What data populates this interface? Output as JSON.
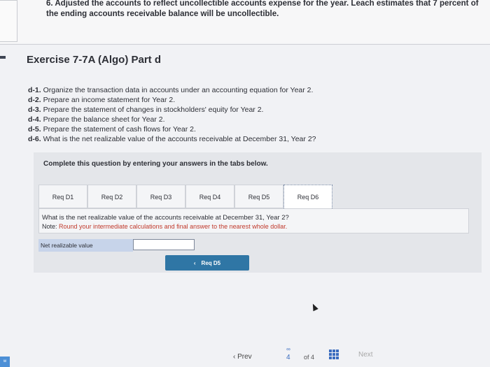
{
  "step": {
    "text": "6. Adjusted the accounts to reflect uncollectible accounts expense for the year. Leach estimates that 7 percent of the ending accounts receivable balance will be uncollectible."
  },
  "exercise": {
    "title": "Exercise 7-7A (Algo) Part d"
  },
  "requirements": [
    {
      "label": "d-1.",
      "text": "Organize the transaction data in accounts under an accounting equation for Year 2."
    },
    {
      "label": "d-2.",
      "text": "Prepare an income statement for Year 2."
    },
    {
      "label": "d-3.",
      "text": "Prepare the statement of changes in stockholders' equity for Year 2."
    },
    {
      "label": "d-4.",
      "text": "Prepare the balance sheet for Year 2."
    },
    {
      "label": "d-5.",
      "text": "Prepare the statement of cash flows for Year 2."
    },
    {
      "label": "d-6.",
      "text": "What is the net realizable value of the accounts receivable at December 31, Year 2?"
    }
  ],
  "panel": {
    "instruction": "Complete this question by entering your answers in the tabs below.",
    "tabs": [
      "Req D1",
      "Req D2",
      "Req D3",
      "Req D4",
      "Req D5",
      "Req D6"
    ],
    "active_tab": "Req D6",
    "question": "What is the net realizable value of the accounts receivable at December 31, Year 2?",
    "note_label": "Note:",
    "note_text": "Round your intermediate calculations and final answer to the nearest whole dollar.",
    "answer_label": "Net realizable value",
    "answer_value": "",
    "prev_tab_button": "Req D5"
  },
  "footer": {
    "badge": "w",
    "prev": "Prev",
    "page": "4",
    "of": "of 4",
    "next": "Next"
  },
  "colors": {
    "accent": "#2f76a5",
    "note_red": "#c0392b",
    "answer_label_bg": "#c7d4ea"
  }
}
